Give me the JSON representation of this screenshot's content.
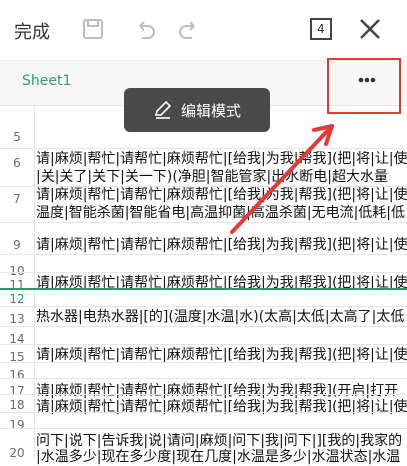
{
  "toolbar": {
    "done_label": "完成",
    "page_count": "4"
  },
  "sheet": {
    "tab_label": "Sheet1"
  },
  "tooltip": {
    "label": "编辑模式"
  },
  "rows": [
    {
      "num": "5",
      "text": ""
    },
    {
      "num": "6",
      "text": "请|麻烦|帮忙|请帮忙|麻烦帮忙|[给我|为我|帮我](把|将|让|使"
    },
    {
      "num": "",
      "text": "|关|关了|关下|关一下)(净胆|智能管家|出水断电|超大水量"
    },
    {
      "num": "7",
      "text": "请|麻烦|帮忙|请帮忙|麻烦帮忙|[给我|为我|帮我](把|将|让|使"
    },
    {
      "num": "",
      "text": "温度|智能杀菌|智能省电|高温抑菌|高温杀菌|无电流|低耗|低"
    },
    {
      "num": "9",
      "text": "请|麻烦|帮忙|请帮忙|麻烦帮忙|[给我|为我|帮我](把|将|让|使"
    },
    {
      "num": "10",
      "text": ""
    },
    {
      "num": "11",
      "text": "请|麻烦|帮忙|请帮忙|麻烦帮忙|[给我|为我|帮我](把|将|让|使"
    },
    {
      "num": "12",
      "text": ""
    },
    {
      "num": "13",
      "text": "热水器|电热水器|[的](温度|水温|水)(太高|太低|太高了|太低"
    },
    {
      "num": "14",
      "text": ""
    },
    {
      "num": "15",
      "text": "请|麻烦|帮忙|请帮忙|麻烦帮忙|[给我|为我|帮我](把|将|让|使"
    },
    {
      "num": "16",
      "text": ""
    },
    {
      "num": "17",
      "text": "请|麻烦|帮忙|请帮忙|麻烦帮忙|[给我|为我|帮我](开启|打开"
    },
    {
      "num": "18",
      "text": "请|麻烦|帮忙|请帮忙|麻烦帮忙|[给我|为我|帮我](把|将|让|使"
    },
    {
      "num": "19",
      "text": ""
    },
    {
      "num": "",
      "text": "问下|说下|告诉我|说|请问|麻烦|问下|我|问下|][我的|我家的"
    },
    {
      "num": "20",
      "text": "|水温多少|现在多少度|现在几度|水温是多少|水温状态|水温"
    }
  ],
  "colors": {
    "accent": "#1f9d6b",
    "highlight": "#e53935",
    "tooltip_bg": "#4a4a4a"
  }
}
